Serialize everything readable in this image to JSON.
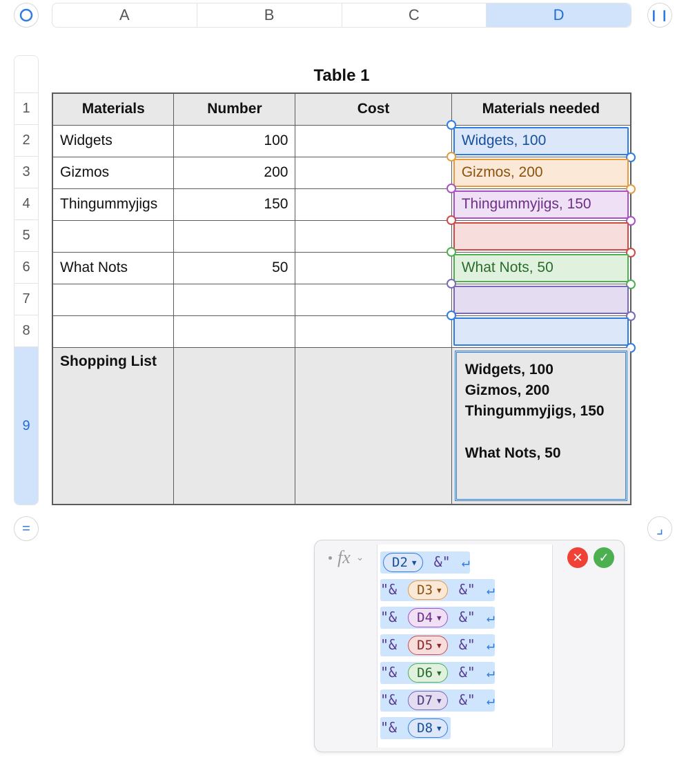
{
  "toolbar": {
    "columns": [
      "A",
      "B",
      "C",
      "D"
    ],
    "selected_column_index": 3
  },
  "rows": {
    "labels": [
      "1",
      "2",
      "3",
      "4",
      "5",
      "6",
      "7",
      "8",
      "9"
    ],
    "selected_row_index": 8
  },
  "table": {
    "title": "Table 1",
    "headers": [
      "Materials",
      "Number",
      "Cost",
      "Materials needed"
    ],
    "body": [
      {
        "materials": "Widgets",
        "number": "100",
        "cost": "",
        "d": "Widgets, 100",
        "color": "blue"
      },
      {
        "materials": "Gizmos",
        "number": "200",
        "cost": "",
        "d": "Gizmos, 200",
        "color": "orange"
      },
      {
        "materials": "Thingummyjigs",
        "number": "150",
        "cost": "",
        "d": "Thingummyjigs, 150",
        "color": "purple"
      },
      {
        "materials": "",
        "number": "",
        "cost": "",
        "d": "",
        "color": "red"
      },
      {
        "materials": "What Nots",
        "number": "50",
        "cost": "",
        "d": "What Nots, 50",
        "color": "green"
      },
      {
        "materials": "",
        "number": "",
        "cost": "",
        "d": "",
        "color": "violet"
      },
      {
        "materials": "",
        "number": "",
        "cost": "",
        "d": "",
        "color": "blue2"
      }
    ],
    "footer": {
      "label": "Shopping List",
      "result": "Widgets, 100\nGizmos, 200\nThingummyjigs, 150\n\nWhat Nots, 50"
    }
  },
  "formula": {
    "fx_label": "fx",
    "lines": [
      {
        "prefix": "",
        "token": "D2",
        "tclass": "t-blue",
        "suffix": "&\"",
        "ret": true
      },
      {
        "prefix": "\"&",
        "token": "D3",
        "tclass": "t-orange",
        "suffix": "&\"",
        "ret": true
      },
      {
        "prefix": "\"&",
        "token": "D4",
        "tclass": "t-purple",
        "suffix": "&\"",
        "ret": true
      },
      {
        "prefix": "\"&",
        "token": "D5",
        "tclass": "t-red",
        "suffix": "&\"",
        "ret": true
      },
      {
        "prefix": "\"&",
        "token": "D6",
        "tclass": "t-green",
        "suffix": "&\"",
        "ret": true
      },
      {
        "prefix": "\"&",
        "token": "D7",
        "tclass": "t-violet",
        "suffix": "&\"",
        "ret": true
      },
      {
        "prefix": "\"&",
        "token": "D8",
        "tclass": "t-blue2",
        "suffix": "",
        "ret": false
      }
    ]
  },
  "icons": {
    "ring": "◯",
    "pause": "❙❙",
    "equals": "=",
    "corner": "⌟",
    "cross": "✕",
    "check": "✓",
    "return": "↵",
    "tri": "▼",
    "caret": "⌄"
  }
}
